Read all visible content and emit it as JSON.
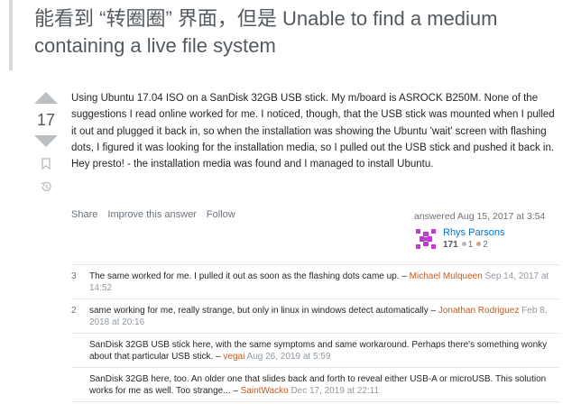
{
  "question": {
    "title": "能看到 “转圈圈” 界面，但是 Unable to find a medium containing a live file system"
  },
  "answer": {
    "score": "17",
    "body": "Using Ubuntu 17.04 ISO on a SanDisk 32GB USB stick. My m/board is ASROCK B250M. None of the suggestions I read online worked for me. I noticed, though, that the USB stick was mounted when I pulled it out and plugged it back in, so when the installation was showing the Ubuntu 'wait' screen with flashing dots, I figured it was looking for the installation media, so I pulled out the USB stick and pushed it back in. Hey presto! - the installation media was found and I managed to install Ubuntu.",
    "actions": [
      "Share",
      "Improve this answer",
      "Follow"
    ],
    "answered": "answered Aug 15, 2017 at 3:54",
    "user": {
      "name": "Rhys Parsons",
      "reputation": "171",
      "silver": "1",
      "bronze": "2"
    }
  },
  "comments": [
    {
      "score": "3",
      "text": "The same worked for me. I pulled it out as soon as the flashing dots came up. –",
      "user": "Michael Mulqueen",
      "date": "Sep 14, 2017 at 14:52"
    },
    {
      "score": "2",
      "text": "same working for me, really strange, but only in linux in windows detect automatically –",
      "user": "Jonathan Rodriguez",
      "date": "Feb 8, 2018 at 20:16"
    },
    {
      "score": "",
      "text": "SanDisk 32GB USB stick here, with the same symptoms and same workaround. Perhaps there's something wonky about that particular USB stick. –",
      "user": "vegai",
      "date": "Aug 26, 2019 at 5:59"
    },
    {
      "score": "",
      "text": "SanDisk 32GB here, too. An older one that slides back and forth to reveal either USB-A or microUSB. This solution works for me as well. Too strange... –",
      "user": "SaintWacko",
      "date": "Dec 17, 2019 at 22:11"
    }
  ],
  "colors": {
    "link": "#0074cc",
    "comment_user": "#c45b1f",
    "silver": "#b4b8bc",
    "bronze": "#d1a684"
  }
}
